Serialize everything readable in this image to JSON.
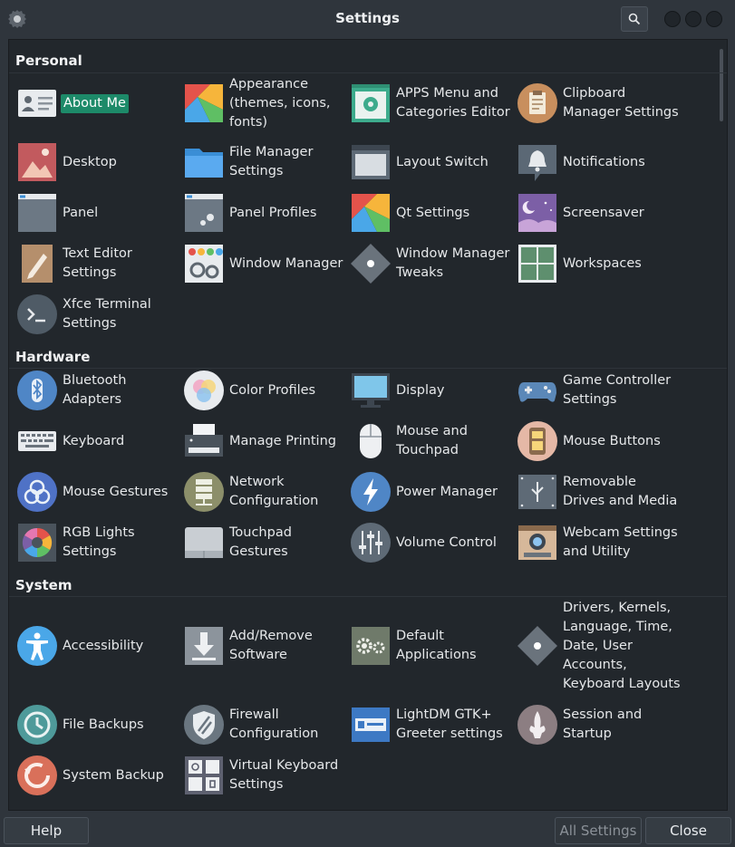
{
  "window": {
    "title": "Settings"
  },
  "sections": {
    "personal": {
      "label": "Personal",
      "items": [
        {
          "label": "About Me",
          "icon": "about-me-icon"
        },
        {
          "label": "Appearance (themes, icons, fonts)",
          "icon": "appearance-icon"
        },
        {
          "label": "APPS Menu and Categories Editor",
          "icon": "apps-menu-icon"
        },
        {
          "label": "Clipboard Manager Settings",
          "icon": "clipboard-icon"
        },
        {
          "label": "Desktop",
          "icon": "desktop-icon"
        },
        {
          "label": "File Manager Settings",
          "icon": "folder-icon"
        },
        {
          "label": "Layout Switch",
          "icon": "layout-switch-icon"
        },
        {
          "label": "Notifications",
          "icon": "bell-icon"
        },
        {
          "label": "Panel",
          "icon": "panel-icon"
        },
        {
          "label": "Panel Profiles",
          "icon": "panel-profiles-icon"
        },
        {
          "label": "Qt Settings",
          "icon": "qt-icon"
        },
        {
          "label": "Screensaver",
          "icon": "screensaver-icon"
        },
        {
          "label": "Text Editor Settings",
          "icon": "pencil-icon"
        },
        {
          "label": "Window Manager",
          "icon": "window-manager-icon"
        },
        {
          "label": "Window Manager Tweaks",
          "icon": "tweaks-icon"
        },
        {
          "label": "Workspaces",
          "icon": "workspaces-icon"
        },
        {
          "label": "Xfce Terminal Settings",
          "icon": "terminal-icon"
        }
      ]
    },
    "hardware": {
      "label": "Hardware",
      "items": [
        {
          "label": "Bluetooth Adapters",
          "icon": "bluetooth-icon"
        },
        {
          "label": "Color Profiles",
          "icon": "color-profiles-icon"
        },
        {
          "label": "Display",
          "icon": "monitor-icon"
        },
        {
          "label": "Game Controller Settings",
          "icon": "gamepad-icon"
        },
        {
          "label": "Keyboard",
          "icon": "keyboard-icon"
        },
        {
          "label": "Manage Printing",
          "icon": "printer-icon"
        },
        {
          "label": "Mouse and Touchpad",
          "icon": "mouse-icon"
        },
        {
          "label": "Mouse Buttons",
          "icon": "mouse-buttons-icon"
        },
        {
          "label": "Mouse Gestures",
          "icon": "gestures-icon"
        },
        {
          "label": "Network Configuration",
          "icon": "network-icon"
        },
        {
          "label": "Power Manager",
          "icon": "power-icon"
        },
        {
          "label": "Removable Drives and Media",
          "icon": "usb-drive-icon"
        },
        {
          "label": "RGB Lights Settings",
          "icon": "rgb-icon"
        },
        {
          "label": "Touchpad Gestures",
          "icon": "touchpad-icon"
        },
        {
          "label": "Volume Control",
          "icon": "sliders-icon"
        },
        {
          "label": "Webcam Settings and Utility",
          "icon": "webcam-icon"
        }
      ]
    },
    "system": {
      "label": "System",
      "items": [
        {
          "label": "Accessibility",
          "icon": "accessibility-icon"
        },
        {
          "label": "Add/Remove Software",
          "icon": "download-icon"
        },
        {
          "label": "Default Applications",
          "icon": "gears-icon"
        },
        {
          "label": "Drivers, Kernels, Language, Time, Date, User Accounts, Keyboard Layouts",
          "icon": "diamond-icon"
        },
        {
          "label": "File Backups",
          "icon": "history-icon"
        },
        {
          "label": "Firewall Configuration",
          "icon": "shield-icon"
        },
        {
          "label": "LightDM GTK+ Greeter settings",
          "icon": "id-card-icon"
        },
        {
          "label": "Session and Startup",
          "icon": "fleur-icon"
        },
        {
          "label": "System Backup",
          "icon": "restore-icon"
        },
        {
          "label": "Virtual Keyboard Settings",
          "icon": "virtual-keyboard-icon"
        }
      ]
    }
  },
  "footer": {
    "help": "Help",
    "all_settings": "All Settings",
    "close": "Close"
  },
  "colors": {
    "accent": "#1d8a69",
    "background": "#22272c",
    "titlebar": "#2f353c"
  }
}
